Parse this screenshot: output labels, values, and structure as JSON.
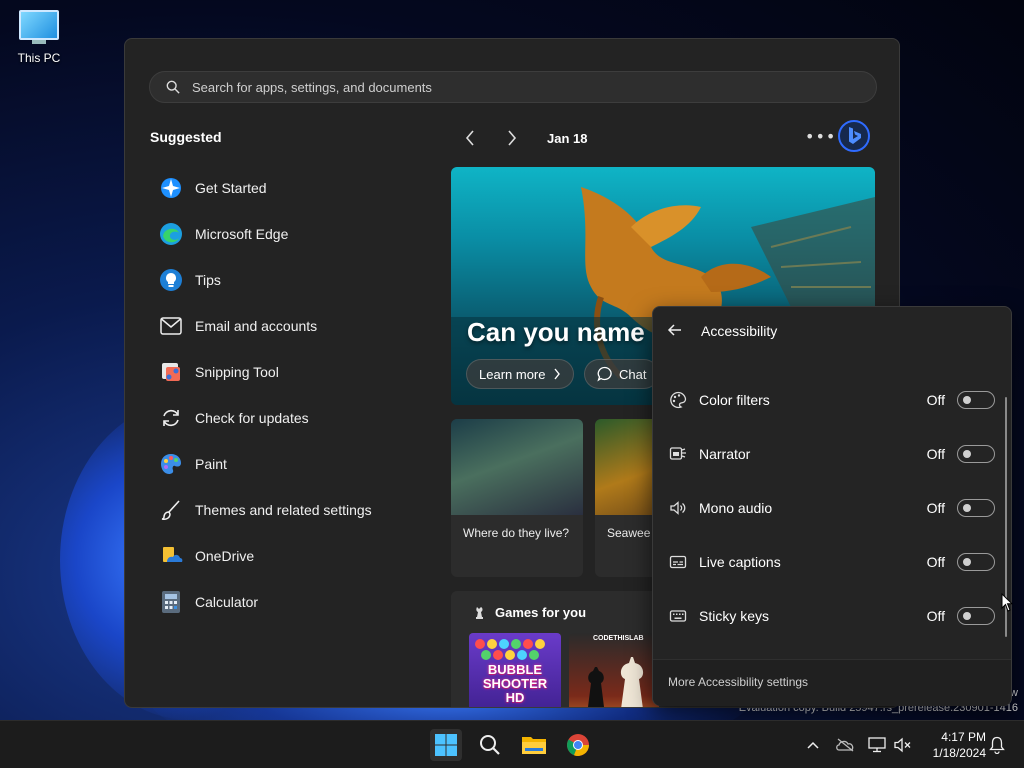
{
  "desktop": {
    "icon_label": "This PC"
  },
  "watermark": {
    "line1": "w",
    "line2": "Evaluation copy. Build 25947.rs_prerelease.230901-1416"
  },
  "start_menu": {
    "search": {
      "placeholder": "Search for apps, settings, and documents"
    },
    "suggested": {
      "title": "Suggested",
      "items": [
        {
          "label": "Get Started",
          "icon": "get-started-icon"
        },
        {
          "label": "Microsoft Edge",
          "icon": "edge-icon"
        },
        {
          "label": "Tips",
          "icon": "tips-icon"
        },
        {
          "label": "Email and accounts",
          "icon": "mail-icon"
        },
        {
          "label": "Snipping Tool",
          "icon": "snipping-tool-icon"
        },
        {
          "label": "Check for updates",
          "icon": "refresh-icon"
        },
        {
          "label": "Paint",
          "icon": "paint-icon"
        },
        {
          "label": "Themes and related settings",
          "icon": "brush-icon"
        },
        {
          "label": "OneDrive",
          "icon": "onedrive-icon"
        },
        {
          "label": "Calculator",
          "icon": "calculator-icon"
        }
      ]
    },
    "feed": {
      "date": "Jan 18",
      "hero": {
        "title": "Can you name",
        "learn_more": "Learn more",
        "chat": "Chat"
      },
      "cards": [
        {
          "text": "Where do they live?"
        },
        {
          "text": "Seawee seadrag"
        }
      ],
      "games": {
        "title": "Games for you",
        "game1": "BUBBLE SHOOTER HD",
        "game2": "CODETHISLAB"
      }
    }
  },
  "accessibility": {
    "title": "Accessibility",
    "items": [
      {
        "label": "Color filters",
        "state": "Off",
        "icon": "color-filter-icon",
        "on": false
      },
      {
        "label": "Narrator",
        "state": "Off",
        "icon": "narrator-icon",
        "on": false
      },
      {
        "label": "Mono audio",
        "state": "Off",
        "icon": "speaker-icon",
        "on": false
      },
      {
        "label": "Live captions",
        "state": "Off",
        "icon": "captions-icon",
        "on": false
      },
      {
        "label": "Sticky keys",
        "state": "Off",
        "icon": "keyboard-icon",
        "on": false
      }
    ],
    "more": "More Accessibility settings"
  },
  "taskbar": {
    "apps": [
      "start-icon",
      "search-icon",
      "file-explorer-icon",
      "chrome-icon"
    ],
    "clock": {
      "time": "4:17 PM",
      "date": "1/18/2024"
    }
  },
  "colors": {
    "accent": "#0078d4",
    "panel": "#232323"
  }
}
